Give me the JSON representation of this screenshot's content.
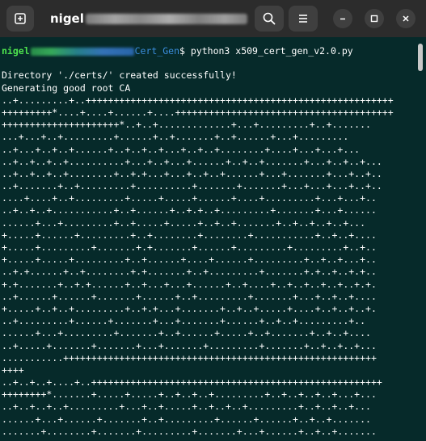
{
  "window": {
    "title": "nigel"
  },
  "icons": {
    "new_tab": "new-tab-icon",
    "search": "search-icon",
    "menu": "hamburger-menu-icon",
    "minimize": "minimize-icon",
    "maximize": "maximize-icon",
    "close": "close-icon"
  },
  "colors": {
    "terminal_bg": "#062a2a",
    "titlebar_bg": "#2c2c2c",
    "prompt_user": "#4ee44e",
    "prompt_path": "#3a8ddc",
    "text": "#ffffff"
  },
  "terminal": {
    "prompt": {
      "user": "nigel",
      "path_suffix": "Cert_Gen",
      "dollar": "$",
      "command": "python3 x509_cert_gen_v2.0.py"
    },
    "output": [
      "",
      "Directory './certs/' created successfully!",
      "Generating good root CA",
      "..+.........+..+++++++++++++++++++++++++++++++++++++++++++++++++++++++",
      "+++++++++*....+....+......+....+++++++++++++++++++++++++++++++++++++++",
      "+++++++++++++++++++++*..+..+.............+...+.........+..+.......",
      "...+...+..+.........+......+..+.......+..+......+...+.........",
      "..+...+..+..+......+..+..+..+...+..+..+........+....+...+...+...",
      "..+..+..+..+..........+...+..+...+......+..+..+.......+...+..+..+...",
      "..+..+..+..+........+..+.+...+...+..+..+......+...+.......+...+..+..",
      "..+.......+..+.........+..........+.......+.......+...+...+...+..+..",
      "....+....+..+.........+.....+.....+......+....+.........+...+...+..",
      "..+..+..+...........+..+......+..+.+..+.........+.......+...+......",
      "......+...+.........+..+.....+.....+..+..+.......+..+..+..+..+...",
      "+.....+......+.........+..+........+........+...........+..+..+....",
      "+.....+.........+.......+.+.......+......+.........+.........+..+..",
      "+.....+.....+.........+..+......+....+......+.........+..+..+...+..",
      "..+.+......+..+........+.+.......+..+.........+.......+.+..+..+.+..",
      "+.+.......+..+.+......+..+...+...+......+..+....+..+..+..+..+..+.+.",
      "..+......+......+.......+......+..+.........+.......+...+..+..+....",
      "+.....+..+..+.........+..+.+...+.......+..+..+.....+....+..+..+..+.",
      "..+.........+......+.......+...+.......+......+..+..+.........+..",
      "......+...+.........+.......+..+......+.....+..+.......+..+..+....",
      "..+.....+.......+.......+...+.......+.........+.......+..+..+..+...",
      "...........++++++++++++++++++++++++++++++++++++++++++++++++++++++++",
      "++++",
      "..+..+..+....+..++++++++++++++++++++++++++++++++++++++++++++++++++++",
      "++++++++*.......+.....+.....+..+..+..+.........+..+..+..+..+...+...",
      "..+..+..+..+.........+...+..+.....+..+..+..+.........+..+..+..+...",
      "......+...+......+.......+..+.........+......+......+..+..+.......",
      ".......+........+.......+.........+.......+...+......+..+..+.......",
      "......+..+....+..+.....+........+..+..+...++++++++++++++++++++++++++"
    ]
  }
}
